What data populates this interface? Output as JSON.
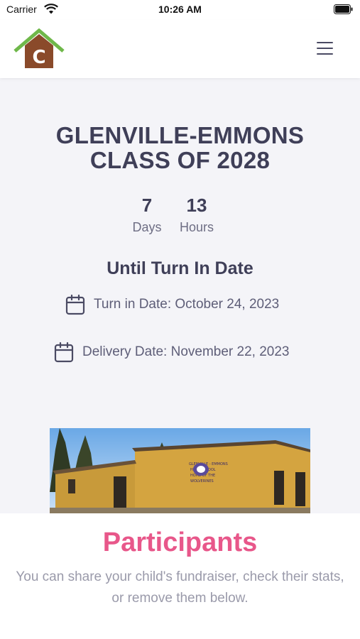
{
  "status": {
    "carrier": "Carrier",
    "time": "10:26 AM"
  },
  "header": {
    "logo_letter": "C"
  },
  "event": {
    "title_line1": "GLENVILLE-EMMONS",
    "title_line2": "CLASS OF 2028",
    "countdown": [
      {
        "value": "7",
        "label": "Days"
      },
      {
        "value": "13",
        "label": "Hours"
      }
    ],
    "until_label": "Until Turn In Date",
    "turn_in": "Turn in Date: October 24, 2023",
    "delivery": "Delivery Date: November 22, 2023",
    "photo_sign": [
      "GLENVILLE - EMMONS",
      "HIGH SCHOOL",
      "HOME OF THE",
      "WOLVERINES"
    ]
  },
  "participants": {
    "title": "Participants",
    "description": "You can share your child's fundraiser, check their stats, or remove them below."
  },
  "colors": {
    "accent": "#e8578a",
    "logo_roof": "#6fb84a",
    "logo_house": "#8a4a2a",
    "text": "#3f3f58"
  }
}
